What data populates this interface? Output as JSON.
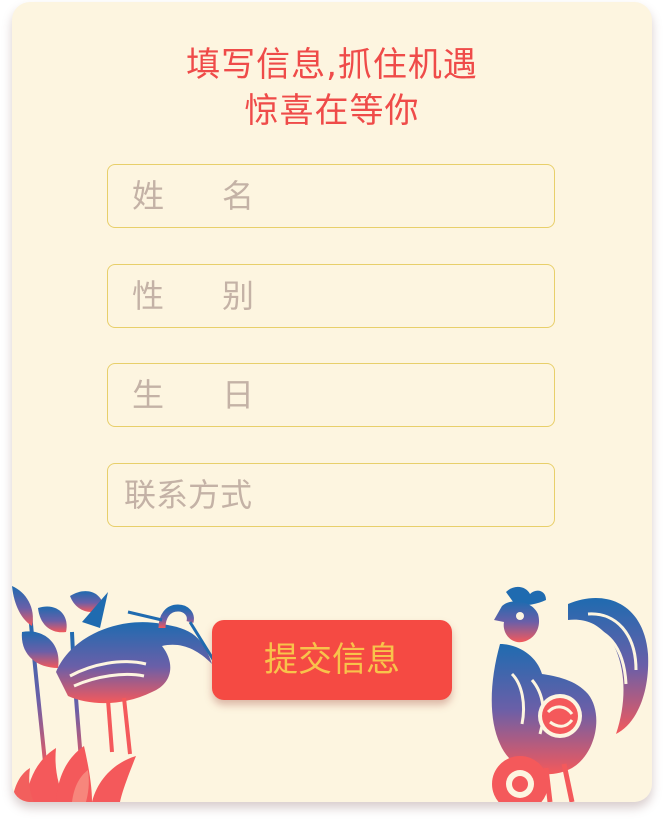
{
  "headline": {
    "line1": "填写信息,抓住机遇",
    "line2": "惊喜在等你"
  },
  "form": {
    "name": {
      "label_a": "姓",
      "label_b": "名"
    },
    "gender": {
      "label_a": "性",
      "label_b": "别"
    },
    "birthday": {
      "label_a": "生",
      "label_b": "日"
    },
    "contact": {
      "label": "联系方式"
    }
  },
  "submit_label": "提交信息",
  "colors": {
    "card_bg": "#fdf5e0",
    "title": "#ef4b49",
    "field_border": "#e8cf6a",
    "placeholder": "#c4b2a6",
    "button_bg": "#f54a43",
    "button_text": "#f8c34b",
    "papercut_blue": "#1f6bb0",
    "papercut_red": "#f4595b"
  },
  "icons": [
    "crane-lotus-papercut",
    "rooster-papercut"
  ]
}
